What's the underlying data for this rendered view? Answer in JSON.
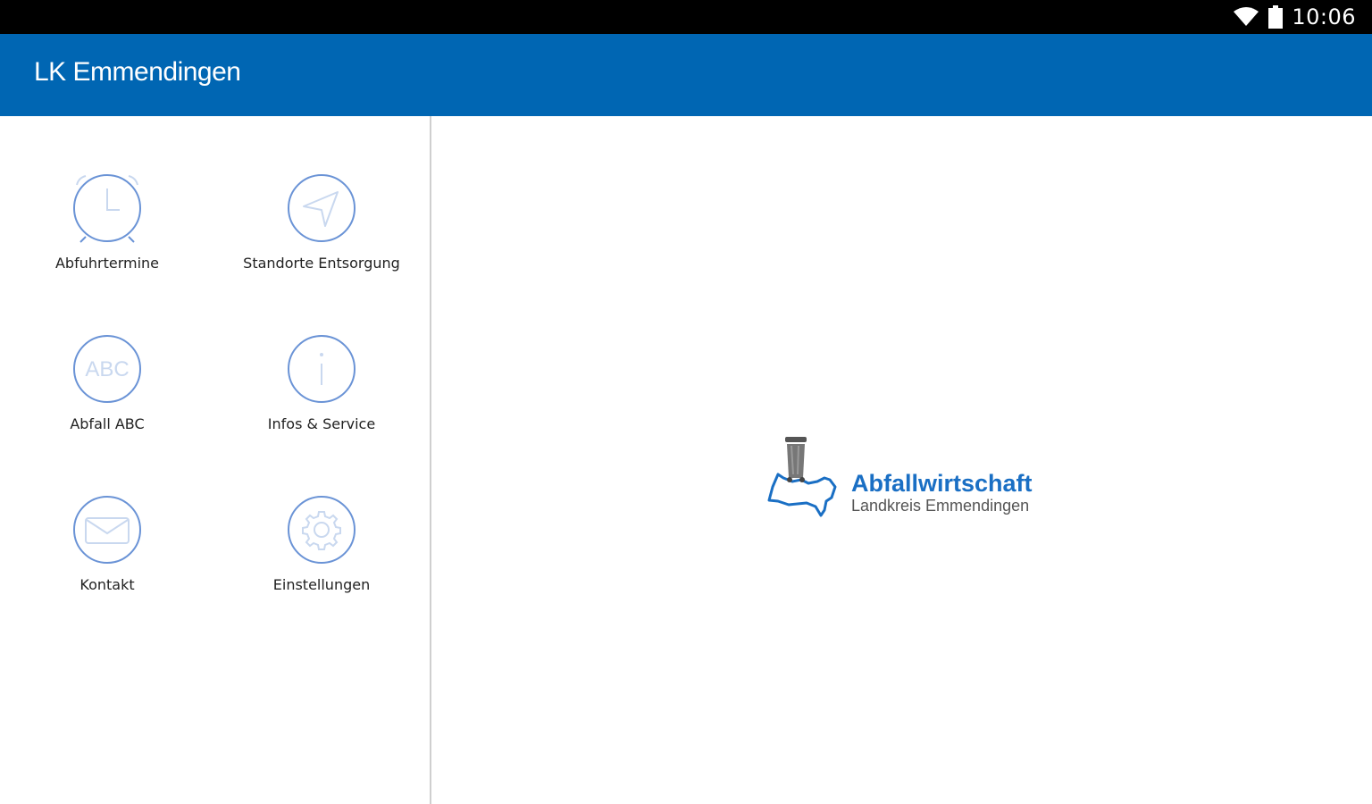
{
  "status_bar": {
    "time": "10:06",
    "icons": [
      "wifi-icon",
      "battery-icon"
    ]
  },
  "app_bar": {
    "title": "LK Emmendingen",
    "color": "#0066b3"
  },
  "menu": {
    "accent_color": "#6a93d6",
    "items": [
      {
        "label": "Abfuhrtermine",
        "icon": "alarm-clock-icon"
      },
      {
        "label": "Standorte Entsorgung",
        "icon": "navigation-arrow-icon"
      },
      {
        "label": "Abfall ABC",
        "icon": "abc-icon",
        "icon_text": "ABC"
      },
      {
        "label": "Infos & Service",
        "icon": "info-icon"
      },
      {
        "label": "Kontakt",
        "icon": "envelope-icon"
      },
      {
        "label": "Einstellungen",
        "icon": "gear-icon"
      }
    ]
  },
  "logo": {
    "title": "Abfallwirtschaft",
    "subtitle": "Landkreis Emmendingen",
    "icon": "trash-bin-icon",
    "color": "#1a6fc4"
  }
}
